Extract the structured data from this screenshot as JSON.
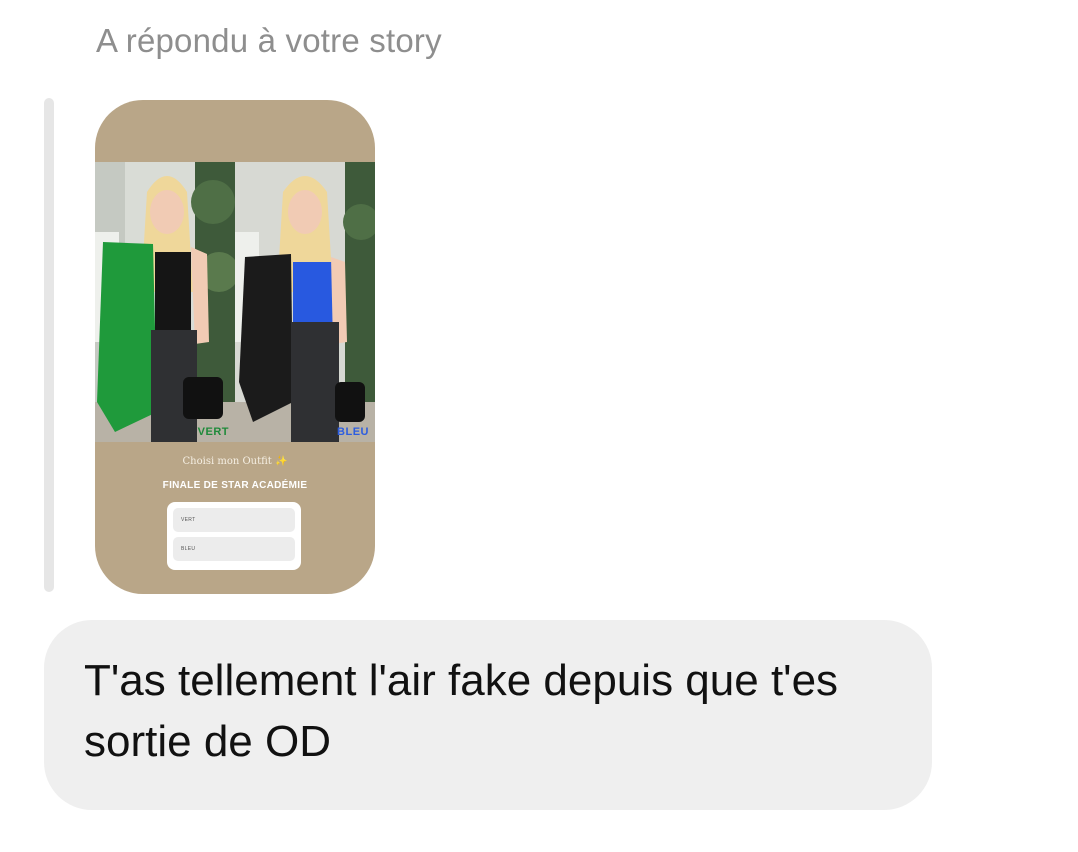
{
  "conversation": {
    "reply_context": "A répondu à votre story"
  },
  "story": {
    "caption": "Choisi mon Outfit ✨",
    "headline": "FINALE DE STAR ACADÉMIE",
    "left_photo_label": "VERT",
    "right_photo_label": "BLEU",
    "poll_options": [
      "VERT",
      "BLEU"
    ],
    "background_color": "#b9a688"
  },
  "message": {
    "text": "T'as tellement l'air fake depuis que t'es sortie de OD"
  }
}
